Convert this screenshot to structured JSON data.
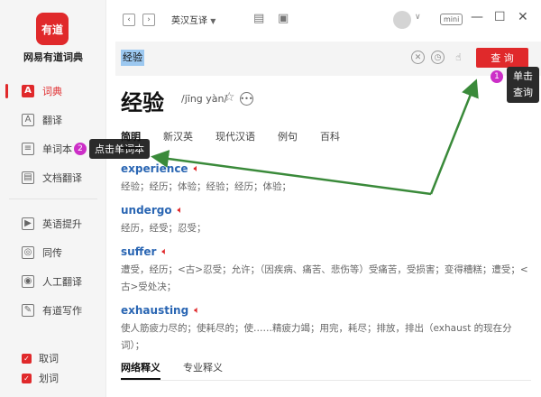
{
  "app": {
    "logo_text": "有道",
    "name": "网易有道词典"
  },
  "sidebar": {
    "items": [
      {
        "label": "词典",
        "icon": "A"
      },
      {
        "label": "翻译",
        "icon": "A"
      },
      {
        "label": "单词本",
        "icon": "≡"
      },
      {
        "label": "文档翻译",
        "icon": "▤"
      },
      {
        "label": "英语提升",
        "icon": "▶"
      },
      {
        "label": "同传",
        "icon": "◎"
      },
      {
        "label": "人工翻译",
        "icon": "◉"
      },
      {
        "label": "有道写作",
        "icon": "✎"
      }
    ],
    "checks": [
      {
        "label": "取词"
      },
      {
        "label": "划词"
      }
    ]
  },
  "toolbar": {
    "lang": "英汉互译",
    "mini": "mini"
  },
  "search": {
    "value": "经验",
    "query_label": "查 询"
  },
  "annotations": {
    "badge1": "1",
    "tip1": "单击查询",
    "badge2": "2",
    "tip2": "点击单词本"
  },
  "word": {
    "headword": "经验",
    "pinyin": "/jīng yàn/"
  },
  "tabs": [
    "简明",
    "新汉英",
    "现代汉语",
    "例句",
    "百科"
  ],
  "entries": [
    {
      "word": "experience",
      "def": "经验；经历；体验；经验；经历；体验；"
    },
    {
      "word": "undergo",
      "def": "经历，经受；忍受；"
    },
    {
      "word": "suffer",
      "def": "遭受，经历；<古>忍受；允许；（因疾病、痛苦、悲伤等）受痛苦，受损害；变得糟糕；遭受；<古>受处决；"
    },
    {
      "word": "exhausting",
      "def": "使人筋疲力尽的；使耗尽的；使……精疲力竭；用完，耗尽；排放，排出（exhaust 的现在分词）；"
    }
  ],
  "bottom_tabs": [
    "网络释义",
    "专业释义"
  ],
  "colors": {
    "accent": "#e0292b",
    "link": "#2a66b3",
    "annotation_badge": "#cc2fc7",
    "arrow": "#3a8a3a"
  }
}
